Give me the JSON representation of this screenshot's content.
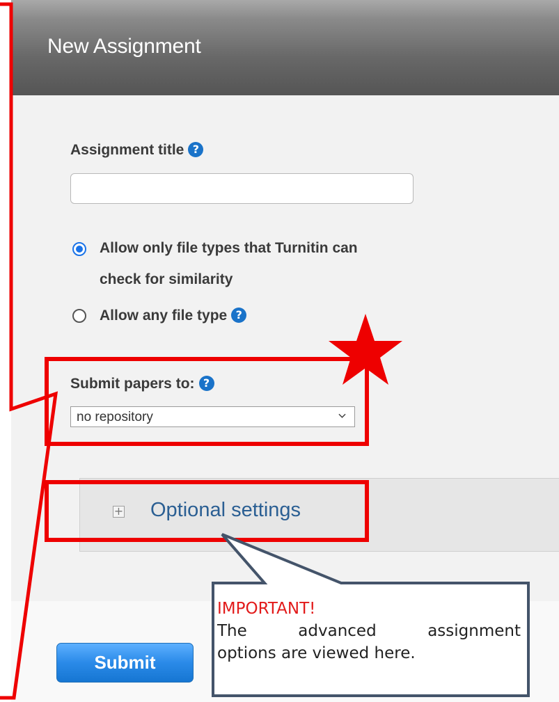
{
  "header": {
    "title": "New Assignment"
  },
  "form": {
    "assignment_title_label": "Assignment title",
    "assignment_title_value": "",
    "help_glyph": "?",
    "file_types": {
      "option1_line1": "Allow only file types that Turnitin can",
      "option1_line2": "check for similarity",
      "option1_selected": true,
      "option2": "Allow any file type",
      "option2_selected": false
    },
    "submit_to_label": "Submit papers to:",
    "submit_to_value": "no repository",
    "optional_settings_label": "Optional settings",
    "plus_glyph": "+",
    "submit_label": "Submit"
  },
  "callout": {
    "title": "IMPORTANT!",
    "line1": "The advanced assignment",
    "line2": "options are viewed here."
  },
  "colors": {
    "highlight": "#ee0000",
    "help_icon": "#1a73c9",
    "link": "#2b5f93",
    "button": "#2a8ae8",
    "callout_border": "#44546a"
  },
  "icons": [
    "help-icon",
    "expand-plus-icon",
    "chevron-down-icon",
    "star-icon"
  ]
}
